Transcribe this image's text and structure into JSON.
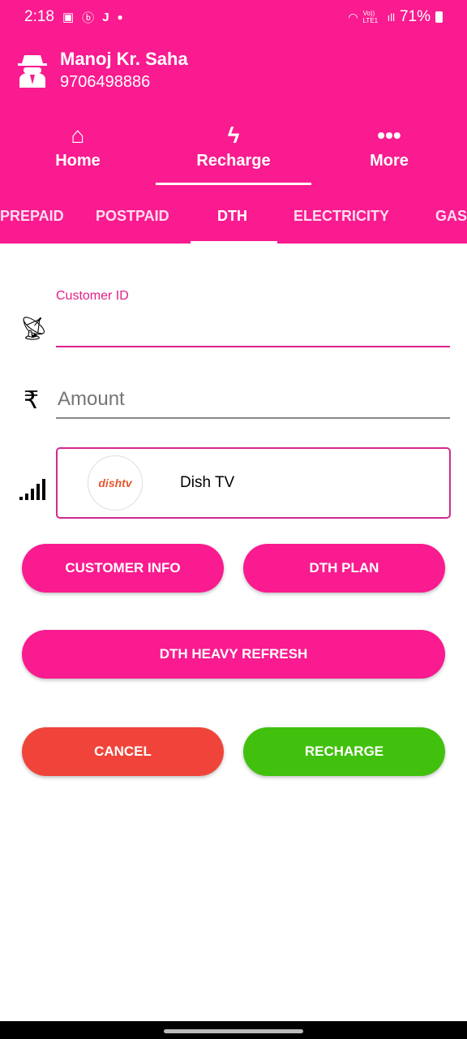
{
  "status": {
    "time": "2:18",
    "icons": [
      "image-icon",
      "b-icon",
      "j-icon",
      "dot-icon"
    ],
    "battery": "71%",
    "network": "Vo)) LTE1"
  },
  "user": {
    "name": "Manoj Kr. Saha",
    "phone": "9706498886"
  },
  "nav": [
    {
      "label": "Home",
      "icon": "home-icon"
    },
    {
      "label": "Recharge",
      "icon": "bolt-icon",
      "active": true
    },
    {
      "label": "More",
      "icon": "more-icon"
    }
  ],
  "tabs": [
    "PREPAID",
    "POSTPAID",
    "DTH",
    "ELECTRICITY",
    "GAS"
  ],
  "active_tab": "DTH",
  "form": {
    "customer_id_label": "Customer ID",
    "customer_id_value": "",
    "amount_placeholder": "Amount",
    "operator": "Dish TV",
    "operator_logo": "dishtv"
  },
  "buttons": {
    "customer_info": "CUSTOMER INFO",
    "dth_plan": "DTH PLAN",
    "heavy_refresh": "DTH HEAVY REFRESH",
    "cancel": "CANCEL",
    "recharge": "RECHARGE"
  },
  "colors": {
    "primary": "#f91b8f",
    "cancel": "#f0443a",
    "recharge": "#41c10e"
  }
}
